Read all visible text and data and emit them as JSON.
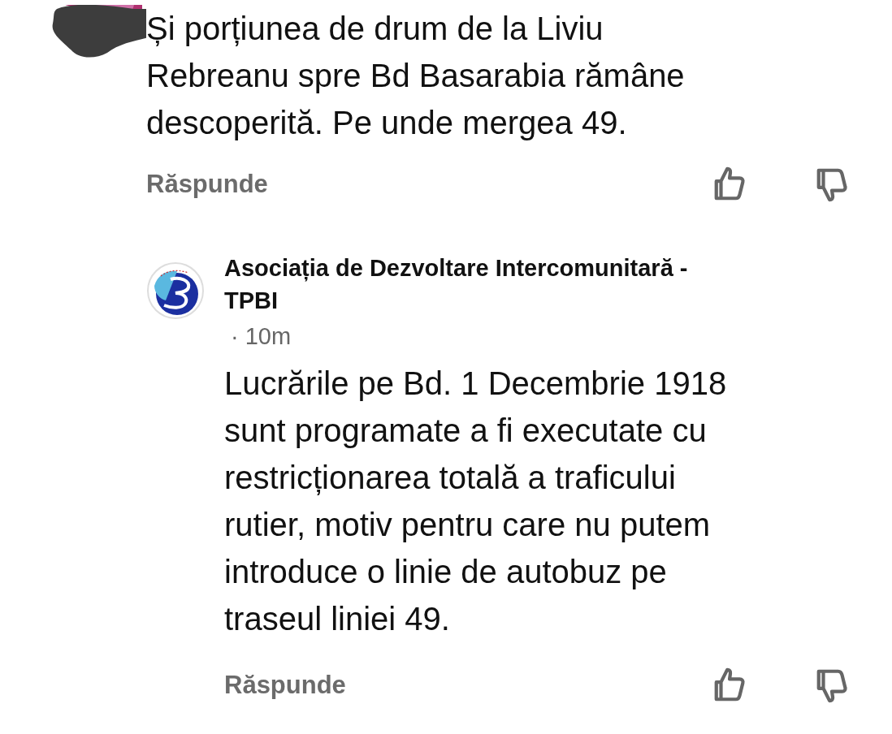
{
  "comments": [
    {
      "avatar": {
        "kind": "redacted"
      },
      "text": "Și porțiunea de drum de la Liviu\nRebreanu spre Bd Basarabia rămâne\ndescoperită. Pe unde mergea 49.",
      "reply_label": "Răspunde",
      "liked": false,
      "disliked": false
    },
    {
      "author": "Asociația de Dezvoltare Intercomunitară -\nTPBI",
      "avatar": {
        "kind": "logo"
      },
      "time": "· 10m",
      "text": "Lucrările pe Bd. 1 Decembrie 1918\nsunt programate a fi executate cu\nrestricționarea totală a traficului\nrutier, motiv pentru care nu putem\nintroduce o linie de autobuz pe\ntraseul liniei 49.",
      "reply_label": "Răspunde",
      "liked": false,
      "disliked": false
    }
  ]
}
